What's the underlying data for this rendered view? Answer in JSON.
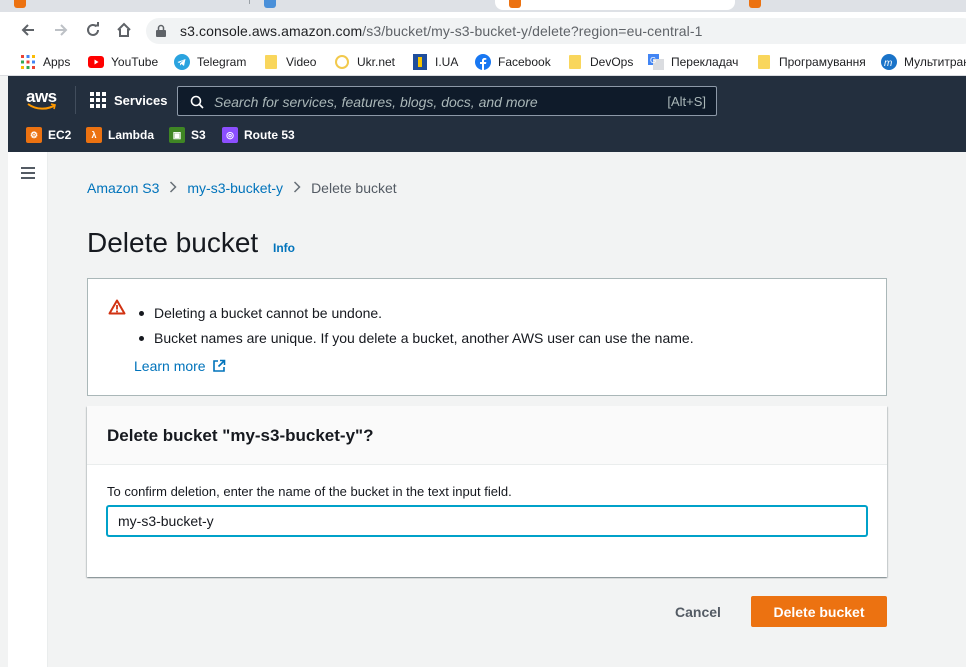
{
  "browser": {
    "url_host": "s3.console.aws.amazon.com",
    "url_path": "/s3/bucket/my-s3-bucket-y/delete?region=eu-central-1"
  },
  "bookmarks": [
    {
      "label": "Apps",
      "icon": "apps-grid-icon"
    },
    {
      "label": "YouTube",
      "icon": "youtube-icon"
    },
    {
      "label": "Telegram",
      "icon": "telegram-icon"
    },
    {
      "label": "Video",
      "icon": "folder-icon"
    },
    {
      "label": "Ukr.net",
      "icon": "ukrnet-icon"
    },
    {
      "label": "I.UA",
      "icon": "iua-icon"
    },
    {
      "label": "Facebook",
      "icon": "facebook-icon"
    },
    {
      "label": "DevOps",
      "icon": "folder-icon"
    },
    {
      "label": "Перекладач",
      "icon": "translate-icon"
    },
    {
      "label": "Програмування",
      "icon": "folder-icon"
    },
    {
      "label": "Мультитран",
      "icon": "multitran-icon"
    }
  ],
  "aws": {
    "logo": "aws",
    "services_label": "Services",
    "search_placeholder": "Search for services, features, blogs, docs, and more",
    "search_shortcut": "[Alt+S]",
    "favorites": [
      {
        "label": "EC2",
        "color": "#ec7211"
      },
      {
        "label": "Lambda",
        "color": "#ec7211"
      },
      {
        "label": "S3",
        "color": "#3f8624"
      },
      {
        "label": "Route 53",
        "color": "#8c4fff"
      }
    ]
  },
  "breadcrumb": {
    "items": [
      "Amazon S3",
      "my-s3-bucket-y"
    ],
    "current": "Delete bucket"
  },
  "page": {
    "title": "Delete bucket",
    "info_label": "Info"
  },
  "alert": {
    "bullets": [
      "Deleting a bucket cannot be undone.",
      "Bucket names are unique. If you delete a bucket, another AWS user can use the name."
    ],
    "learn_more": "Learn more"
  },
  "confirm": {
    "heading": "Delete bucket \"my-s3-bucket-y\"?",
    "instruction": "To confirm deletion, enter the name of the bucket in the text input field.",
    "input_value": "my-s3-bucket-y"
  },
  "actions": {
    "cancel": "Cancel",
    "delete": "Delete bucket"
  },
  "colors": {
    "primary_button": "#ec7211",
    "link": "#0073bb",
    "aws_nav": "#232f3e",
    "warning": "#d13212"
  }
}
